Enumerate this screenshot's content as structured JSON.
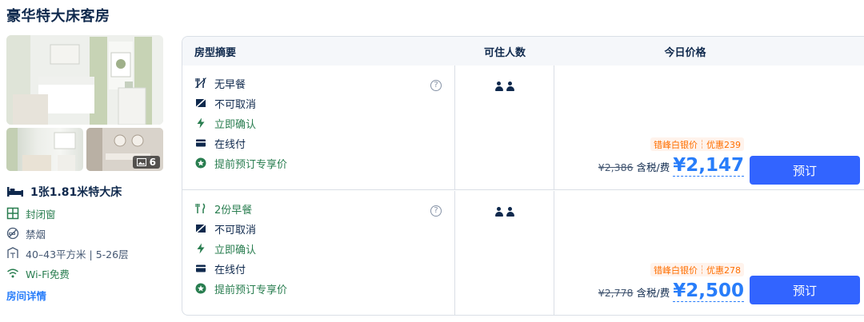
{
  "room": {
    "title": "豪华特大床客房",
    "photo_count": "6",
    "bed": "1张1.81米特大床",
    "features": [
      {
        "icon": "window-icon",
        "label": "封闭窗"
      },
      {
        "icon": "no-smoking-icon",
        "label": "禁烟"
      },
      {
        "icon": "area-icon",
        "label": "40–43平方米 | 5-26层"
      },
      {
        "icon": "wifi-icon",
        "label": "Wi-Fi免费"
      }
    ],
    "detail_link": "房间详情"
  },
  "table": {
    "headers": {
      "summary": "房型摘要",
      "occupancy": "可住人数",
      "price": "今日价格"
    }
  },
  "offers": [
    {
      "meal": "无早餐",
      "cancel": "不可取消",
      "confirm": "立即确认",
      "pay": "在线付",
      "perk": "提前预订专享价",
      "help": "?",
      "promo_name": "错峰白银价",
      "promo_discount": "优惠239",
      "original_price": "¥2,386",
      "tax_label": "含税/费",
      "final_price": "¥2,147",
      "book_label": "预订"
    },
    {
      "meal": "2份早餐",
      "cancel": "不可取消",
      "confirm": "立即确认",
      "pay": "在线付",
      "perk": "提前预订专享价",
      "help": "?",
      "promo_name": "错峰白银价",
      "promo_discount": "优惠278",
      "original_price": "¥2,778",
      "tax_label": "含税/费",
      "final_price": "¥2,500",
      "book_label": "预订"
    }
  ],
  "colors": {
    "accent": "#287dfa",
    "button": "#3264ff",
    "green": "#287d4f",
    "promo": "#ff6f00"
  }
}
